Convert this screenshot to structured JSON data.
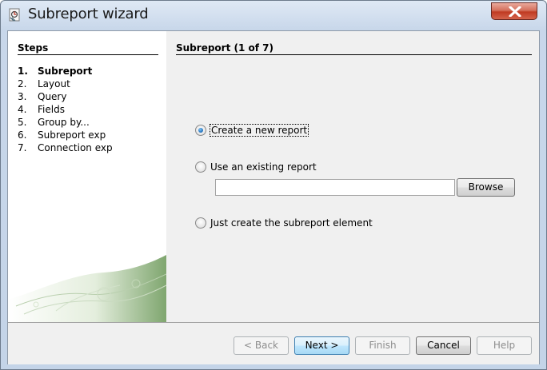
{
  "window": {
    "title": "Subreport wizard"
  },
  "steps": {
    "title": "Steps",
    "items": [
      {
        "num": "1.",
        "label": "Subreport"
      },
      {
        "num": "2.",
        "label": "Layout"
      },
      {
        "num": "3.",
        "label": "Query"
      },
      {
        "num": "4.",
        "label": "Fields"
      },
      {
        "num": "5.",
        "label": "Group by..."
      },
      {
        "num": "6.",
        "label": "Subreport exp"
      },
      {
        "num": "7.",
        "label": "Connection exp"
      }
    ]
  },
  "content": {
    "title": "Subreport (1 of 7)",
    "options": {
      "new_report": "Create a new report",
      "existing_report": "Use an existing report",
      "just_element": "Just create the subreport element"
    },
    "existing_path_value": "",
    "browse_label": "Browse"
  },
  "buttons": {
    "back": "< Back",
    "next": "Next >",
    "finish": "Finish",
    "cancel": "Cancel",
    "help": "Help"
  }
}
